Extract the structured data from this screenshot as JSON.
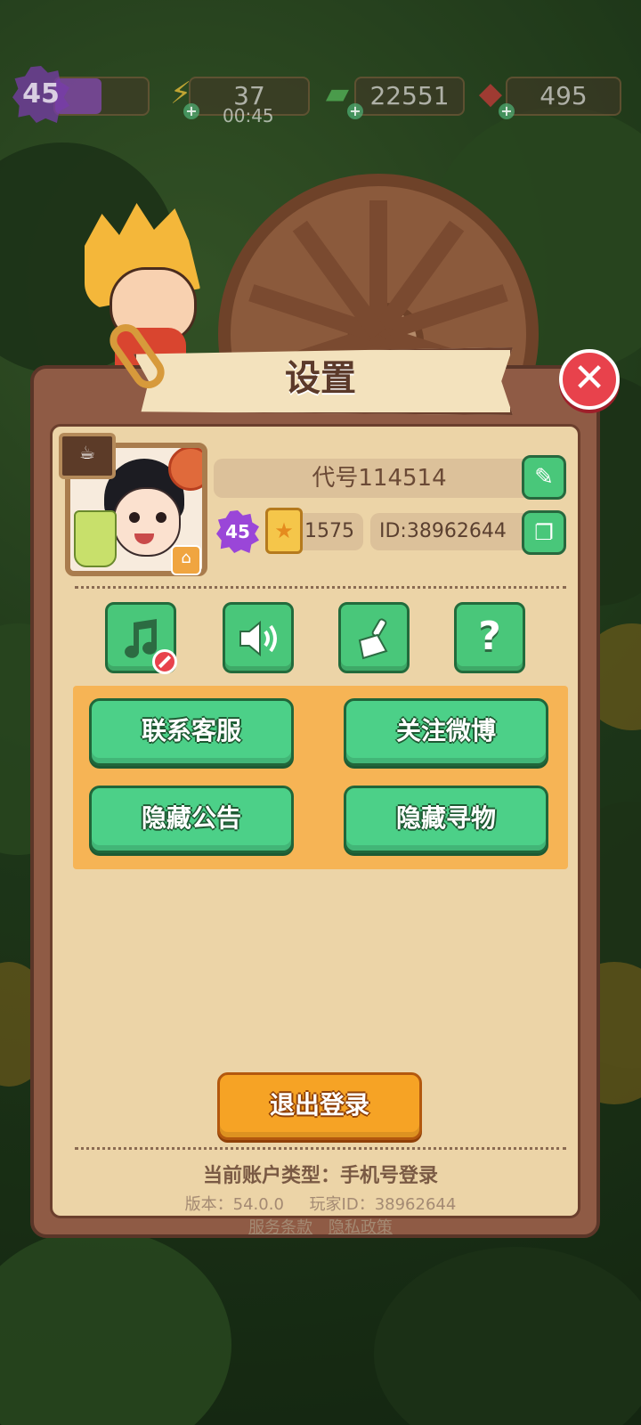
{
  "hud": {
    "level": "45",
    "xp_fill": 0.5,
    "energy": "37",
    "energy_timer": "00:45",
    "cash": "22551",
    "gems": "495"
  },
  "dialog": {
    "title": "设置",
    "close_icon": "close-icon"
  },
  "profile": {
    "name": "代号114514",
    "level": "45",
    "stars": "1575",
    "player_id": "ID:38962644"
  },
  "icons": {
    "music": "music-off-icon",
    "sound": "speaker-icon",
    "clean": "broom-icon",
    "help": "question-icon"
  },
  "actions": {
    "contact_support": "联系客服",
    "follow_weibo": "关注微博",
    "hide_announcement": "隐藏公告",
    "hide_search": "隐藏寻物"
  },
  "logout": "退出登录",
  "footer": {
    "account_type": "当前账户类型：手机号登录",
    "version": "版本：54.0.0",
    "player_id": "玩家ID：38962644",
    "terms": "服务条款",
    "privacy": "隐私政策"
  },
  "colors": {
    "green_button": "#4cd088",
    "orange_button": "#f6a325",
    "panel_bg": "#ecd4a7",
    "close_red": "#e8424c"
  }
}
